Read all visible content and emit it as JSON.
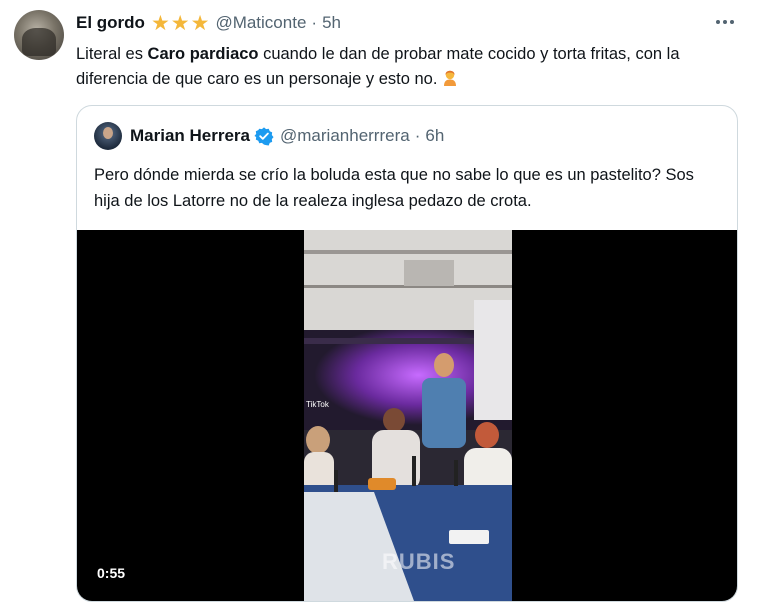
{
  "tweet": {
    "author_name": "El gordo",
    "stars": [
      "★",
      "★",
      "★"
    ],
    "handle": "@Maticonte",
    "separator": "·",
    "time": "5h",
    "text_pre": "Literal es ",
    "text_bold": "Caro pardiaco",
    "text_post": " cuando le dan de probar mate cocido y torta fritas, con la diferencia de que caro es un personaje y esto no.",
    "emoji_icon": "person-gesturing-icon"
  },
  "quote": {
    "author_name": "Marian Herrera",
    "verified_icon": "verified-badge-icon",
    "handle": "@marianherrrera",
    "separator": "·",
    "time": "6h",
    "text": "Pero dónde mierda se crío la boluda esta que no sabe lo que es un pastelito? Sos hija de los Latorre no de la realeza inglesa pedazo de crota."
  },
  "video": {
    "duration": "0:55",
    "tiktok_label": "TikTok",
    "watermark": "RUBIS"
  },
  "colors": {
    "star": "#f4b73a",
    "verified": "#1d9bf0",
    "muted": "#536471",
    "border": "#cfd9de"
  }
}
